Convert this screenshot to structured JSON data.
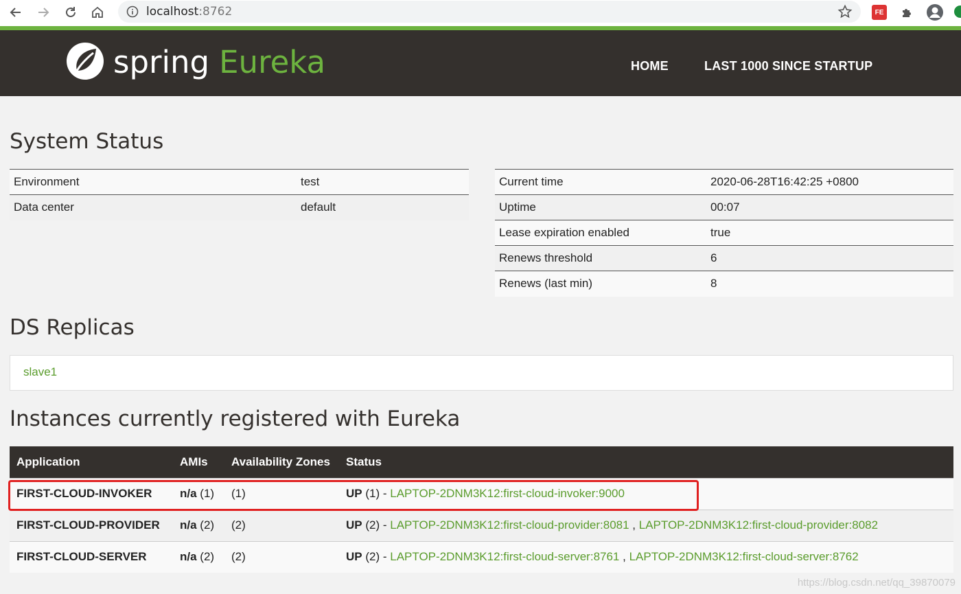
{
  "browser": {
    "url_host": "localhost",
    "url_port": ":8762",
    "icons": [
      "back-icon",
      "forward-icon",
      "reload-icon",
      "home-icon",
      "info-icon",
      "star-icon",
      "extension-icon",
      "puzzle-icon",
      "profile-icon"
    ],
    "extension_label": "FE"
  },
  "header": {
    "brand_main": "spring",
    "brand_accent": "Eureka",
    "nav": [
      "HOME",
      "LAST 1000 SINCE STARTUP"
    ],
    "accent_color": "#6db33f",
    "bg_color": "#34302d"
  },
  "system_status": {
    "title": "System Status",
    "left": [
      {
        "label": "Environment",
        "value": "test"
      },
      {
        "label": "Data center",
        "value": "default"
      }
    ],
    "right": [
      {
        "label": "Current time",
        "value": "2020-06-28T16:42:25 +0800"
      },
      {
        "label": "Uptime",
        "value": "00:07"
      },
      {
        "label": "Lease expiration enabled",
        "value": "true"
      },
      {
        "label": "Renews threshold",
        "value": "6"
      },
      {
        "label": "Renews (last min)",
        "value": "8"
      }
    ]
  },
  "ds_replicas": {
    "title": "DS Replicas",
    "items": [
      "slave1"
    ]
  },
  "instances": {
    "title": "Instances currently registered with Eureka",
    "headers": [
      "Application",
      "AMIs",
      "Availability Zones",
      "Status"
    ],
    "rows": [
      {
        "application": "FIRST-CLOUD-INVOKER",
        "amis_bold": "n/a",
        "amis_count": " (1)",
        "zones": "(1)",
        "status_bold": "UP",
        "status_count": " (1) - ",
        "links": [
          "LAPTOP-2DNM3K12:first-cloud-invoker:9000"
        ]
      },
      {
        "application": "FIRST-CLOUD-PROVIDER",
        "amis_bold": "n/a",
        "amis_count": " (2)",
        "zones": "(2)",
        "status_bold": "UP",
        "status_count": " (2) - ",
        "links": [
          "LAPTOP-2DNM3K12:first-cloud-provider:8081",
          "LAPTOP-2DNM3K12:first-cloud-provider:8082"
        ]
      },
      {
        "application": "FIRST-CLOUD-SERVER",
        "amis_bold": "n/a",
        "amis_count": " (2)",
        "zones": "(2)",
        "status_bold": "UP",
        "status_count": " (2) - ",
        "links": [
          "LAPTOP-2DNM3K12:first-cloud-server:8761",
          "LAPTOP-2DNM3K12:first-cloud-server:8762"
        ]
      }
    ],
    "link_separator": " , "
  },
  "watermark": "https://blog.csdn.net/qq_39870079"
}
